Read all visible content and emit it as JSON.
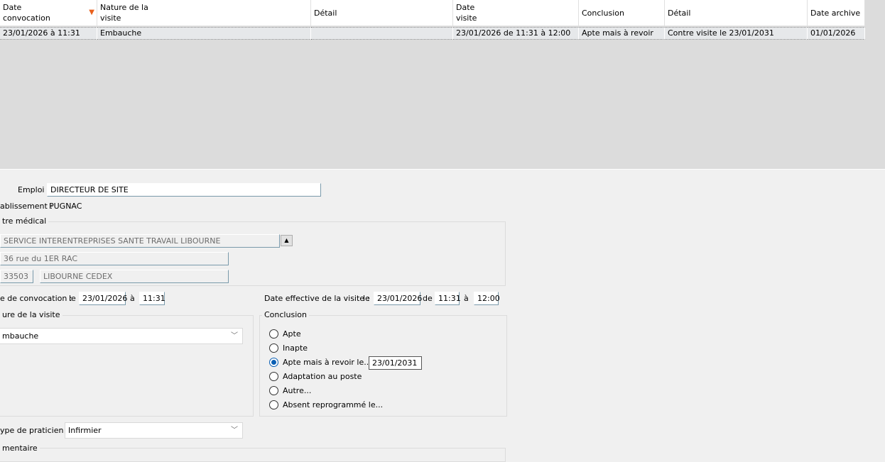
{
  "table": {
    "headers": [
      "Date convocation",
      "Nature de la visite",
      "Détail",
      "Date visite",
      "Conclusion",
      "Détail",
      "Date archive"
    ],
    "sort_indicator": "sort-desc-icon",
    "rows": [
      [
        "23/01/2026 à 11:31",
        "Embauche",
        "",
        "23/01/2026 de 11:31 à 12:00",
        "Apte mais à revoir",
        "Contre visite le 23/01/2031",
        "01/01/2026"
      ]
    ]
  },
  "form": {
    "emploi_label": "Emploi :",
    "emploi_value": "DIRECTEUR DE SITE",
    "etablissement_label": "ablissement :",
    "etablissement_value": "PUGNAC",
    "centre_title": "tre médical",
    "centre_name": "SERVICE INTERENTREPRISES SANTE TRAVAIL LIBOURNE",
    "centre_address": "36 rue du 1ER RAC",
    "centre_cp": "33503",
    "centre_city": "LIBOURNE CEDEX",
    "convocation_label": "e de convocation :",
    "le": "le",
    "a": "à",
    "de": "de",
    "convocation_date": "23/01/2026",
    "convocation_time": "11:31",
    "effective_label": "Date effective de la visite :",
    "effective_date": "23/01/2026",
    "effective_from": "11:31",
    "effective_to": "12:00",
    "nature_title": "ure de la visite",
    "nature_value": "mbauche",
    "conclusion_title": "Conclusion",
    "conclusion_options": [
      "Apte",
      "Inapte",
      "Apte mais à revoir le...",
      "Adaptation au poste",
      "Autre...",
      "Absent reprogrammé le..."
    ],
    "conclusion_selected": 2,
    "revoir_date": "23/01/2031",
    "praticien_label": "ype de praticien :",
    "praticien_value": "Infirmier",
    "commentaire_title": "mentaire"
  },
  "colors": {
    "sort_arrow": "#e8601c",
    "radio_selected": "#0a5fb4"
  }
}
